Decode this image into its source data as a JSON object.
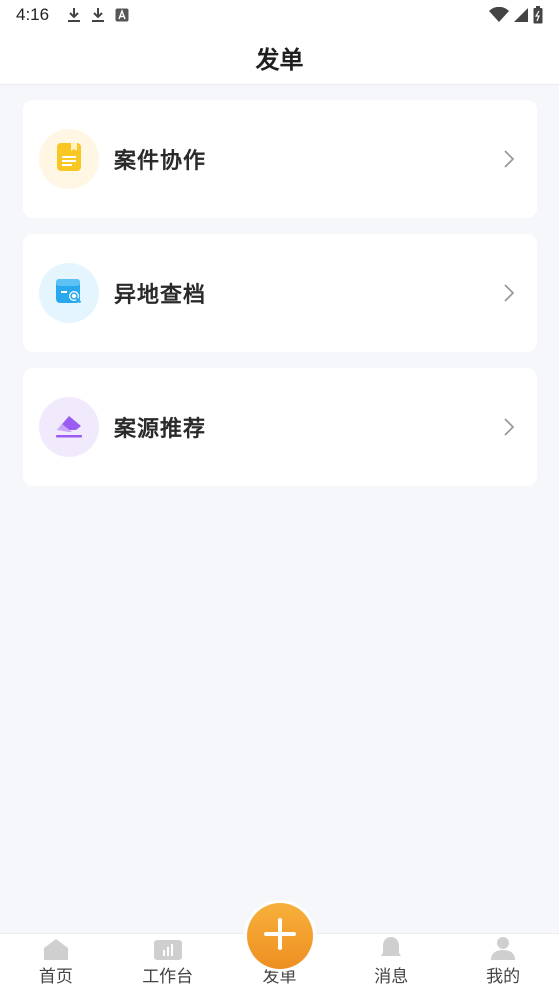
{
  "status_bar": {
    "time": "4:16",
    "icons": [
      "download-icon",
      "download-icon",
      "font-icon",
      "wifi-icon",
      "signal-icon",
      "battery-icon"
    ]
  },
  "header": {
    "title": "发单"
  },
  "menu": [
    {
      "label": "案件协作",
      "icon": "document-icon",
      "icon_color": "#f9c623",
      "bg_color": "#fff6e4"
    },
    {
      "label": "异地查档",
      "icon": "archive-search-icon",
      "icon_color": "#2aa8ee",
      "bg_color": "#e4f5fd"
    },
    {
      "label": "案源推荐",
      "icon": "eraser-icon",
      "icon_color": "#9a5cf2",
      "bg_color": "#f1eafd"
    }
  ],
  "bottom_nav": {
    "items": [
      {
        "label": "首页",
        "icon": "home-icon"
      },
      {
        "label": "工作台",
        "icon": "chart-icon"
      },
      {
        "label": "发单",
        "icon": "plus-icon"
      },
      {
        "label": "消息",
        "icon": "bell-icon"
      },
      {
        "label": "我的",
        "icon": "user-icon"
      }
    ],
    "fab_color": "#f2a02e"
  }
}
